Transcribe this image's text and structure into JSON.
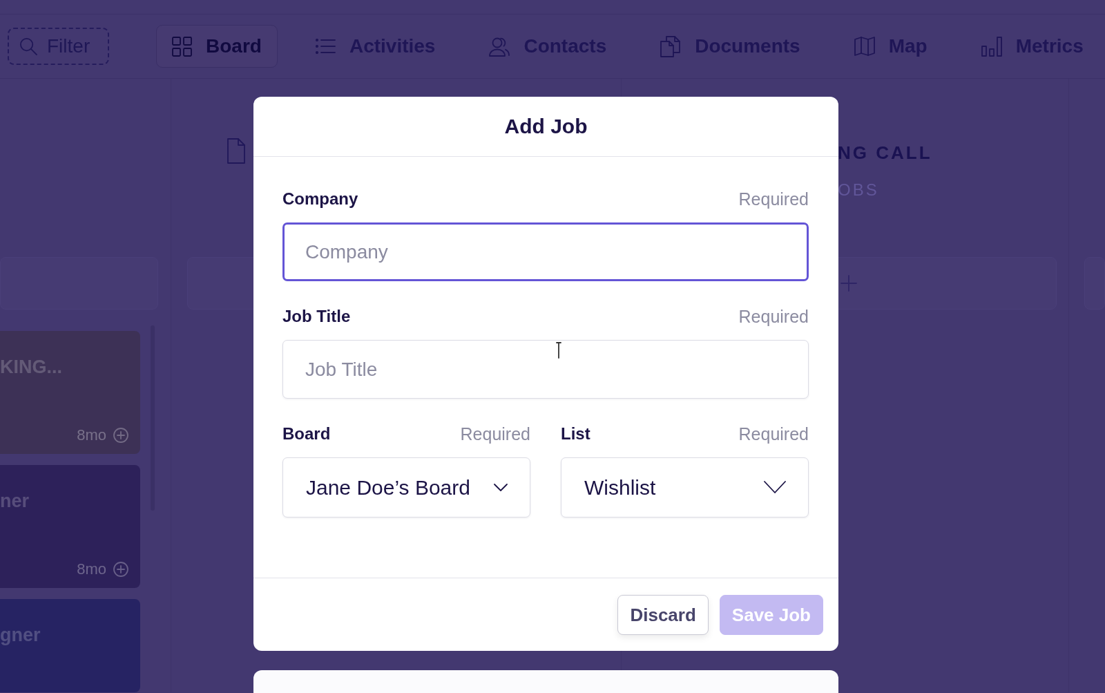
{
  "toolbar": {
    "filter": {
      "label": "Filter"
    },
    "tabs": [
      {
        "label": "Board",
        "selected": true
      },
      {
        "label": "Activities",
        "selected": false
      },
      {
        "label": "Contacts",
        "selected": false
      },
      {
        "label": "Documents",
        "selected": false
      },
      {
        "label": "Map",
        "selected": false
      },
      {
        "label": "Metrics",
        "selected": false
      }
    ]
  },
  "board": {
    "left_list": {
      "cards": [
        {
          "title": "KING...",
          "age": "8mo",
          "color": "#3d3156"
        },
        {
          "title": "ner",
          "age": "8mo",
          "color": "#2d215a"
        },
        {
          "title": "gner",
          "color": "#262363"
        }
      ]
    },
    "right_list": {
      "title": "NG CALL",
      "subtitle": "OBS"
    }
  },
  "modal": {
    "title": "Add Job",
    "fields": [
      {
        "label": "Company",
        "hint": "Required",
        "placeholder": "Company",
        "focused": true
      },
      {
        "label": "Job Title",
        "hint": "Required",
        "placeholder": "Job Title",
        "focused": false
      }
    ],
    "selects": [
      {
        "label": "Board",
        "hint": "Required",
        "value": "Jane Doe’s Board"
      },
      {
        "label": "List",
        "hint": "Required",
        "value": "Wishlist"
      }
    ],
    "buttons": [
      {
        "label": "Discard",
        "kind": "secondary",
        "disabled": false
      },
      {
        "label": "Save Job",
        "kind": "primary",
        "disabled": true
      }
    ]
  }
}
